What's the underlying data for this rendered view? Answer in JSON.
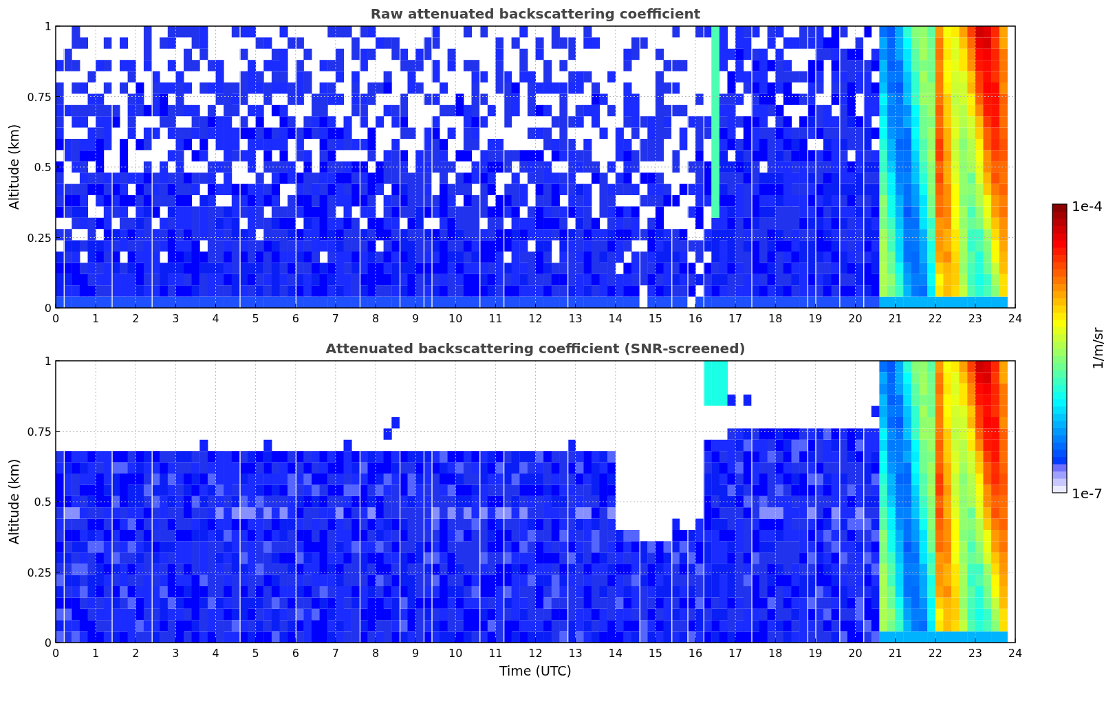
{
  "figure": {
    "panels": [
      {
        "kind": "raw",
        "title": "Raw attenuated backscattering coefficient",
        "ylabel": "Altitude (km)",
        "yticks": [
          "1",
          "0.75",
          "0.5",
          "0.25",
          "0"
        ],
        "xticks": [
          "0",
          "1",
          "2",
          "3",
          "4",
          "5",
          "6",
          "7",
          "8",
          "9",
          "10",
          "11",
          "12",
          "13",
          "14",
          "15",
          "16",
          "17",
          "18",
          "19",
          "20",
          "21",
          "22",
          "23",
          "24"
        ]
      },
      {
        "kind": "screened",
        "title": "Attenuated backscattering coefficient (SNR-screened)",
        "ylabel": "Altitude (km)",
        "yticks": [
          "1",
          "0.75",
          "0.5",
          "0.25",
          "0"
        ],
        "xticks": [
          "0",
          "1",
          "2",
          "3",
          "4",
          "5",
          "6",
          "7",
          "8",
          "9",
          "10",
          "11",
          "12",
          "13",
          "14",
          "15",
          "16",
          "17",
          "18",
          "19",
          "20",
          "21",
          "22",
          "23",
          "24"
        ],
        "xlabel": "Time (UTC)"
      }
    ],
    "colorbar": {
      "label": "1/m/sr",
      "max": "1e-4",
      "min": "1e-7"
    }
  }
}
